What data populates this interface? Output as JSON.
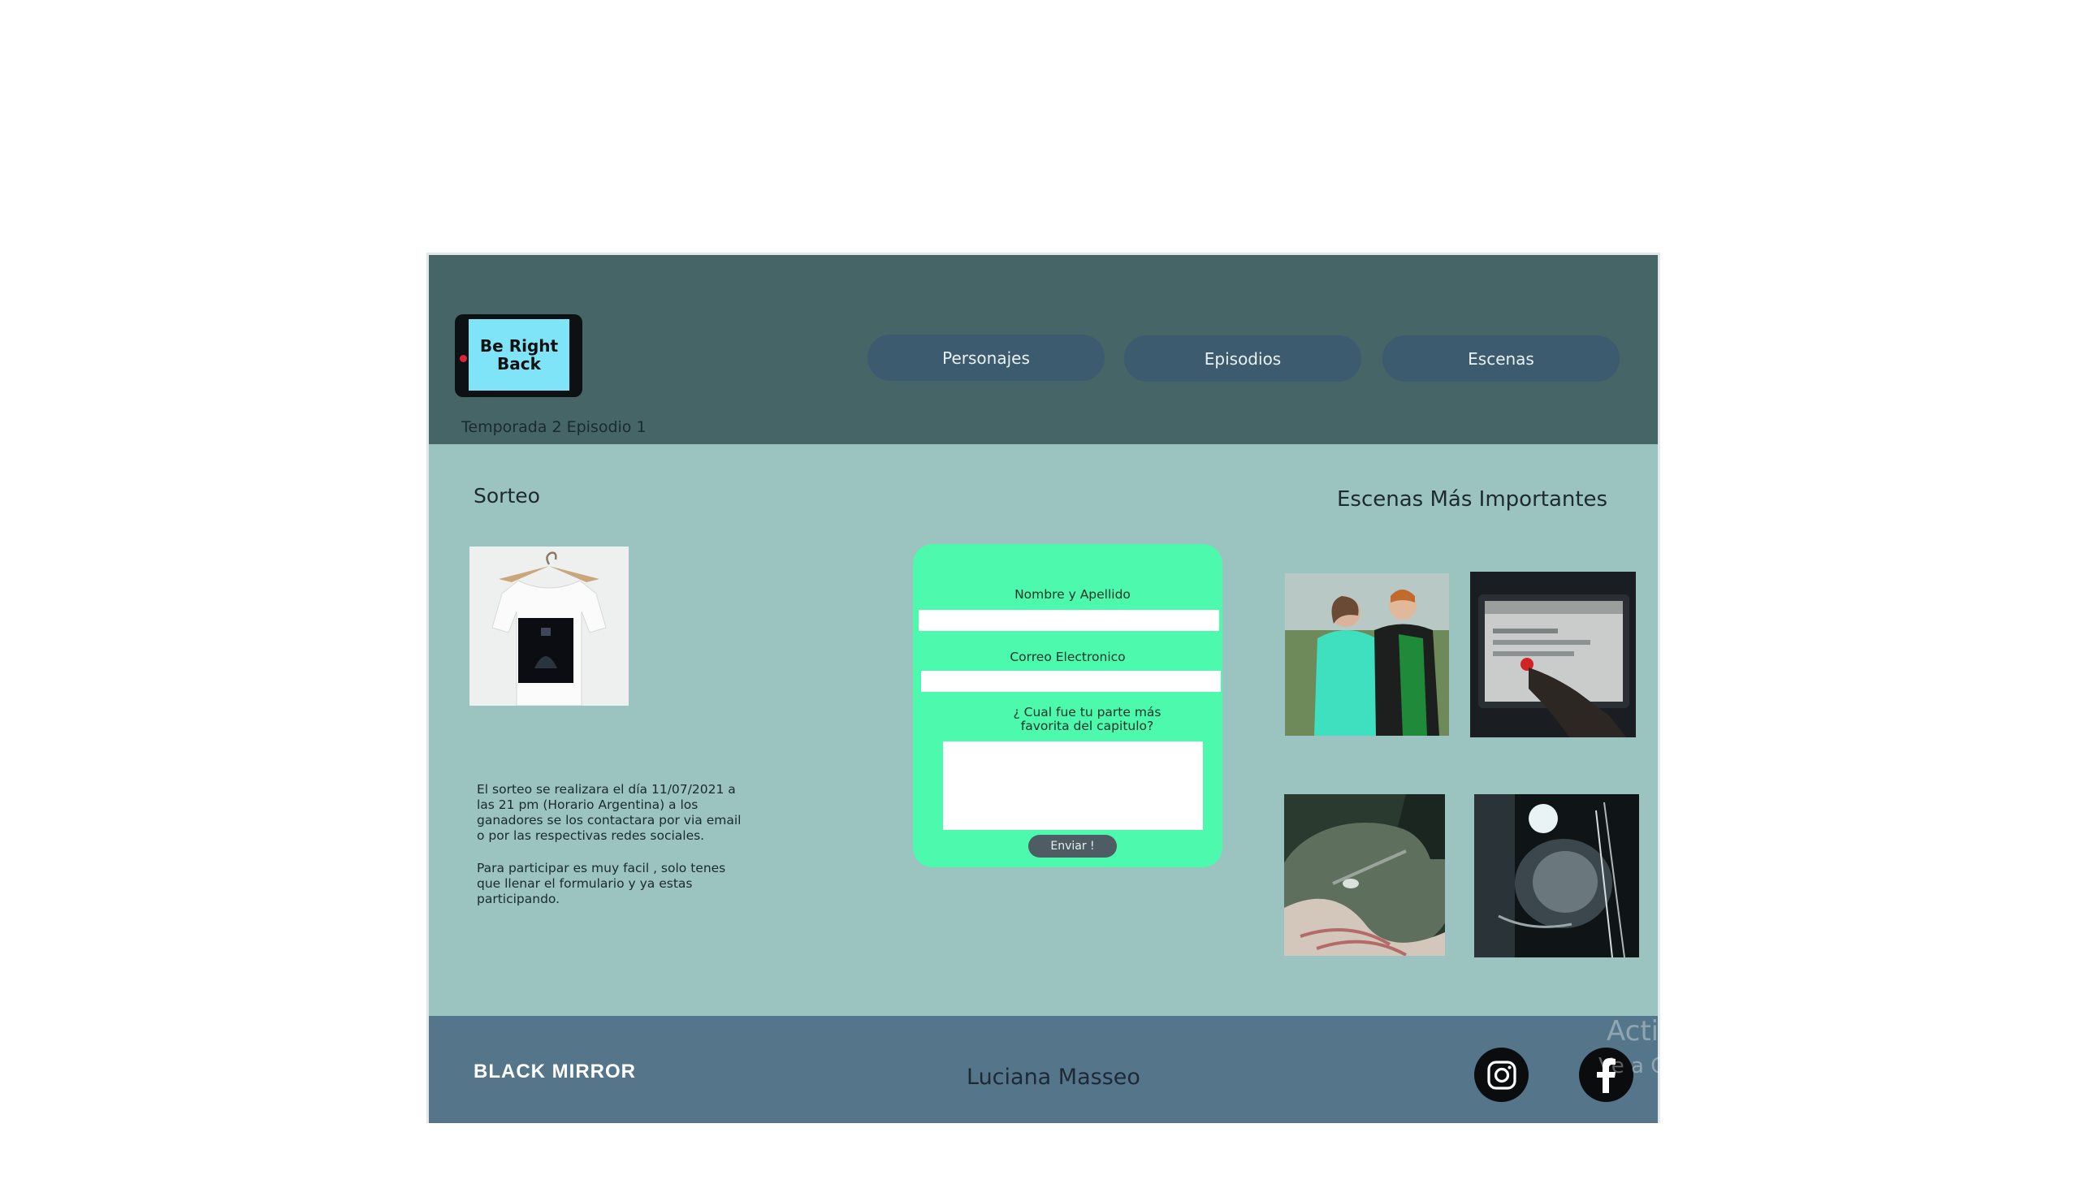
{
  "header": {
    "logo_text": "Be Right Back",
    "subtitle": "Temporada 2 Episodio 1",
    "nav": [
      {
        "label": "Personajes"
      },
      {
        "label": "Episodios"
      },
      {
        "label": "Escenas"
      }
    ]
  },
  "sorteo": {
    "title": "Sorteo",
    "paragraphs": [
      "El sorteo se realizara el día 11/07/2021 a las 21 pm (Horario Argentina) a los ganadores se los contactara por via email o por las respectivas redes sociales.",
      "Para participar es muy facil , solo tenes que llenar el formulario y ya estas participando."
    ]
  },
  "form": {
    "name_label": "Nombre y Apellido",
    "email_label": "Correo Electronico",
    "question_label": "¿ Cual fue tu parte más favorita del capitulo?",
    "submit_label": "Enviar !"
  },
  "escenas": {
    "title": "Escenas Más Importantes"
  },
  "footer": {
    "logo": "BLACK MIRROR",
    "author": "Luciana Masseo"
  },
  "watermark": {
    "line1": "Activ",
    "line2": "Ve a C"
  },
  "icons": {
    "instagram": "instagram-icon",
    "facebook": "facebook-icon"
  }
}
